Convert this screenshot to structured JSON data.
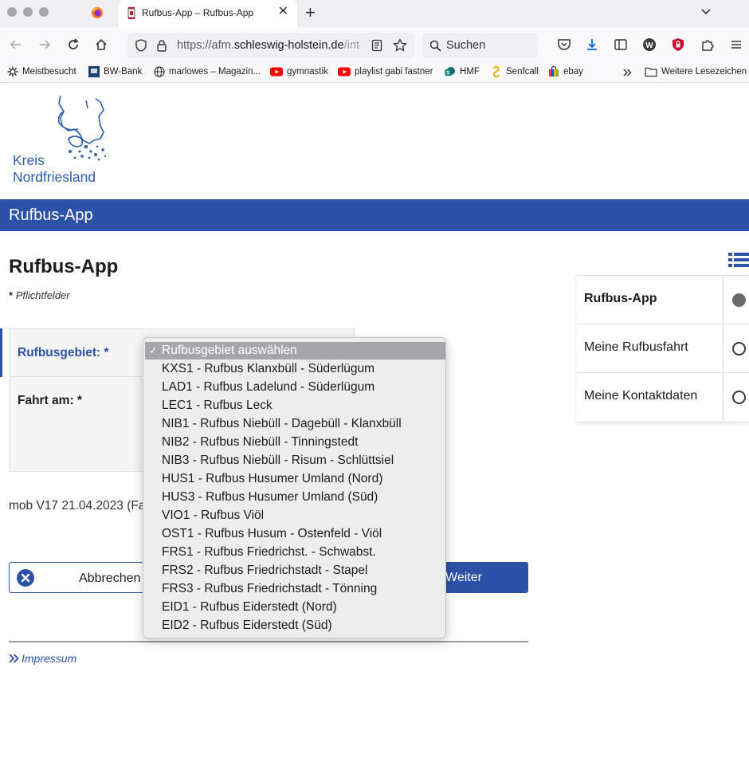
{
  "browser": {
    "tab_title": "Rufbus-App – Rufbus-App",
    "url_prefix": "https://afm.",
    "url_domain": "schleswig-holstein.de",
    "url_suffix": "/inte",
    "search_placeholder": "Suchen",
    "bookmarks": [
      "Meistbesucht",
      "BW-Bank",
      "marlowes – Magazin...",
      "gymnastik",
      "playlist gabi fastner",
      "HMF",
      "Senfcall",
      "ebay"
    ],
    "bookmarks_more": "Weitere Lesezeichen"
  },
  "logo": {
    "line1": "Kreis",
    "line2": "Nordfriesland",
    "color": "#2a5db0"
  },
  "appbar": {
    "title": "Rufbus-App",
    "color": "#2c51a6"
  },
  "main": {
    "page_title": "Rufbus-App",
    "required_star": "*",
    "required_text": "Pflichtfelder",
    "rufbusgebiet_label": "Rufbusgebiet: *",
    "fahrt_label": "Fahrt am: *",
    "version": "mob V17 21.04.2023 (Fa",
    "cancel_label": "Abbrechen",
    "next_label": "Weiter",
    "impressum": "Impressum"
  },
  "dropdown": {
    "selected": "Rufbusgebiet auswählen",
    "options": [
      "Rufbusgebiet auswählen",
      "KXS1 - Rufbus Klanxbüll - Süderlügum",
      "LAD1 - Rufbus Ladelund - Süderlügum",
      "LEC1 - Rufbus Leck",
      "NIB1 - Rufbus Niebüll - Dagebüll - Klanxbüll",
      "NIB2 - Rufbus Niebüll - Tinningstedt",
      "NIB3 - Rufbus Niebüll - Risum - Schlüttsiel",
      "HUS1 - Rufbus Husumer Umland (Nord)",
      "HUS3 - Rufbus Husumer Umland (Süd)",
      "VIO1 - Rufbus Viöl",
      "OST1 - Rufbus Husum - Ostenfeld - Viöl",
      "FRS1 - Rufbus Friedrichst. - Schwabst.",
      "FRS2 - Rufbus Friedrichstadt - Stapel",
      "FRS3 - Rufbus Friedrichstadt - Tönning",
      "EID1 - Rufbus Eiderstedt (Nord)",
      "EID2 - Rufbus Eiderstedt (Süd)"
    ]
  },
  "sidenav": {
    "items": [
      {
        "label": "Rufbus-App",
        "active": true
      },
      {
        "label": "Meine Rufbusfahrt",
        "active": false
      },
      {
        "label": "Meine Kontaktdaten",
        "active": false
      }
    ]
  }
}
